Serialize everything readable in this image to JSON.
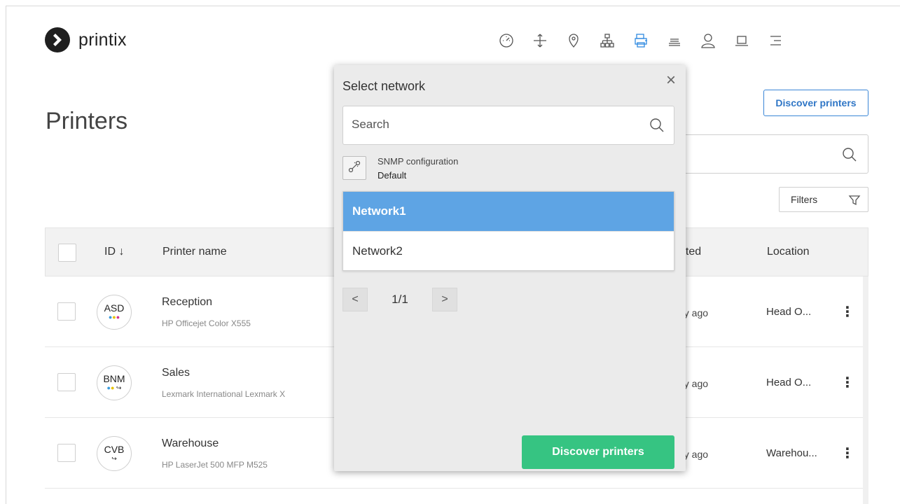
{
  "app": {
    "name": "printix"
  },
  "nav": {
    "icons": [
      "dashboard-icon",
      "move-icon",
      "location-icon",
      "network-icon",
      "printers-icon",
      "queue-icon",
      "user-icon",
      "computer-icon",
      "menu-icon"
    ],
    "active": "printers-icon"
  },
  "page": {
    "title": "Printers",
    "discover_label": "Discover printers",
    "filters_label": "Filters"
  },
  "table": {
    "headers": {
      "id": "ID ↓",
      "name": "Printer name",
      "created": "ated",
      "location": "Location"
    },
    "rows": [
      {
        "id": "ASD",
        "name": "Reception",
        "model": "HP Officejet Color X555",
        "created": "ay ago",
        "location": "Head O..."
      },
      {
        "id": "BNM",
        "name": "Sales",
        "model": "Lexmark International Lexmark X",
        "created": "ay ago",
        "location": "Head O..."
      },
      {
        "id": "CVB",
        "name": "Warehouse",
        "model": "HP LaserJet 500 MFP M525",
        "created": "ay ago",
        "location": "Warehou..."
      }
    ]
  },
  "modal": {
    "title": "Select network",
    "close": "×",
    "search_placeholder": "Search",
    "snmp_label": "SNMP configuration",
    "snmp_value": "Default",
    "networks": [
      "Network1",
      "Network2"
    ],
    "selected_network": "Network1",
    "pager": {
      "prev": "<",
      "page": "1/1",
      "next": ">"
    },
    "discover_label": "Discover printers"
  },
  "colors": {
    "accent": "#2f8ae0",
    "selected": "#5ea4e4",
    "primary_action": "#36c482"
  }
}
